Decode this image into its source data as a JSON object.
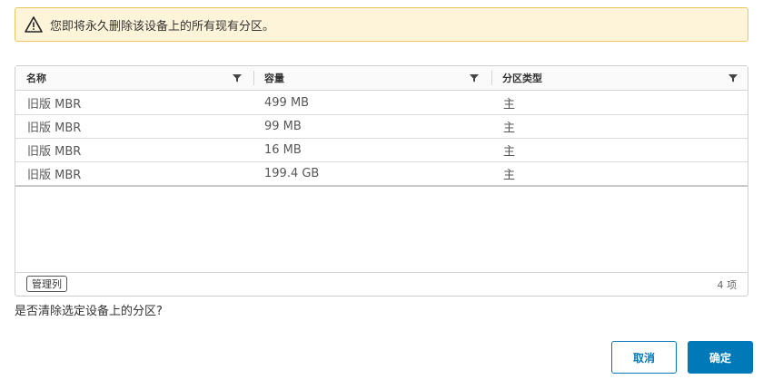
{
  "alert": {
    "icon": "warning-icon",
    "message": "您即将永久删除该设备上的所有现有分区。",
    "border_color": "#efc75e",
    "background": "#fdf4d9"
  },
  "grid": {
    "columns": [
      {
        "label": "名称",
        "filter_icon": "filter-icon"
      },
      {
        "label": "容量",
        "filter_icon": "filter-icon"
      },
      {
        "label": "分区类型",
        "filter_icon": "filter-icon"
      }
    ],
    "rows": [
      {
        "name": "旧版 MBR",
        "capacity": "499 MB",
        "type": "主"
      },
      {
        "name": "旧版 MBR",
        "capacity": "99 MB",
        "type": "主"
      },
      {
        "name": "旧版 MBR",
        "capacity": "16 MB",
        "type": "主"
      },
      {
        "name": "旧版 MBR",
        "capacity": "199.4 GB",
        "type": "主"
      }
    ],
    "footer": {
      "manage_columns_label": "管理列",
      "item_count": "4 项"
    }
  },
  "question": "是否清除选定设备上的分区?",
  "buttons": {
    "cancel": "取消",
    "ok": "确定"
  },
  "colors": {
    "primary": "#0079b8"
  }
}
